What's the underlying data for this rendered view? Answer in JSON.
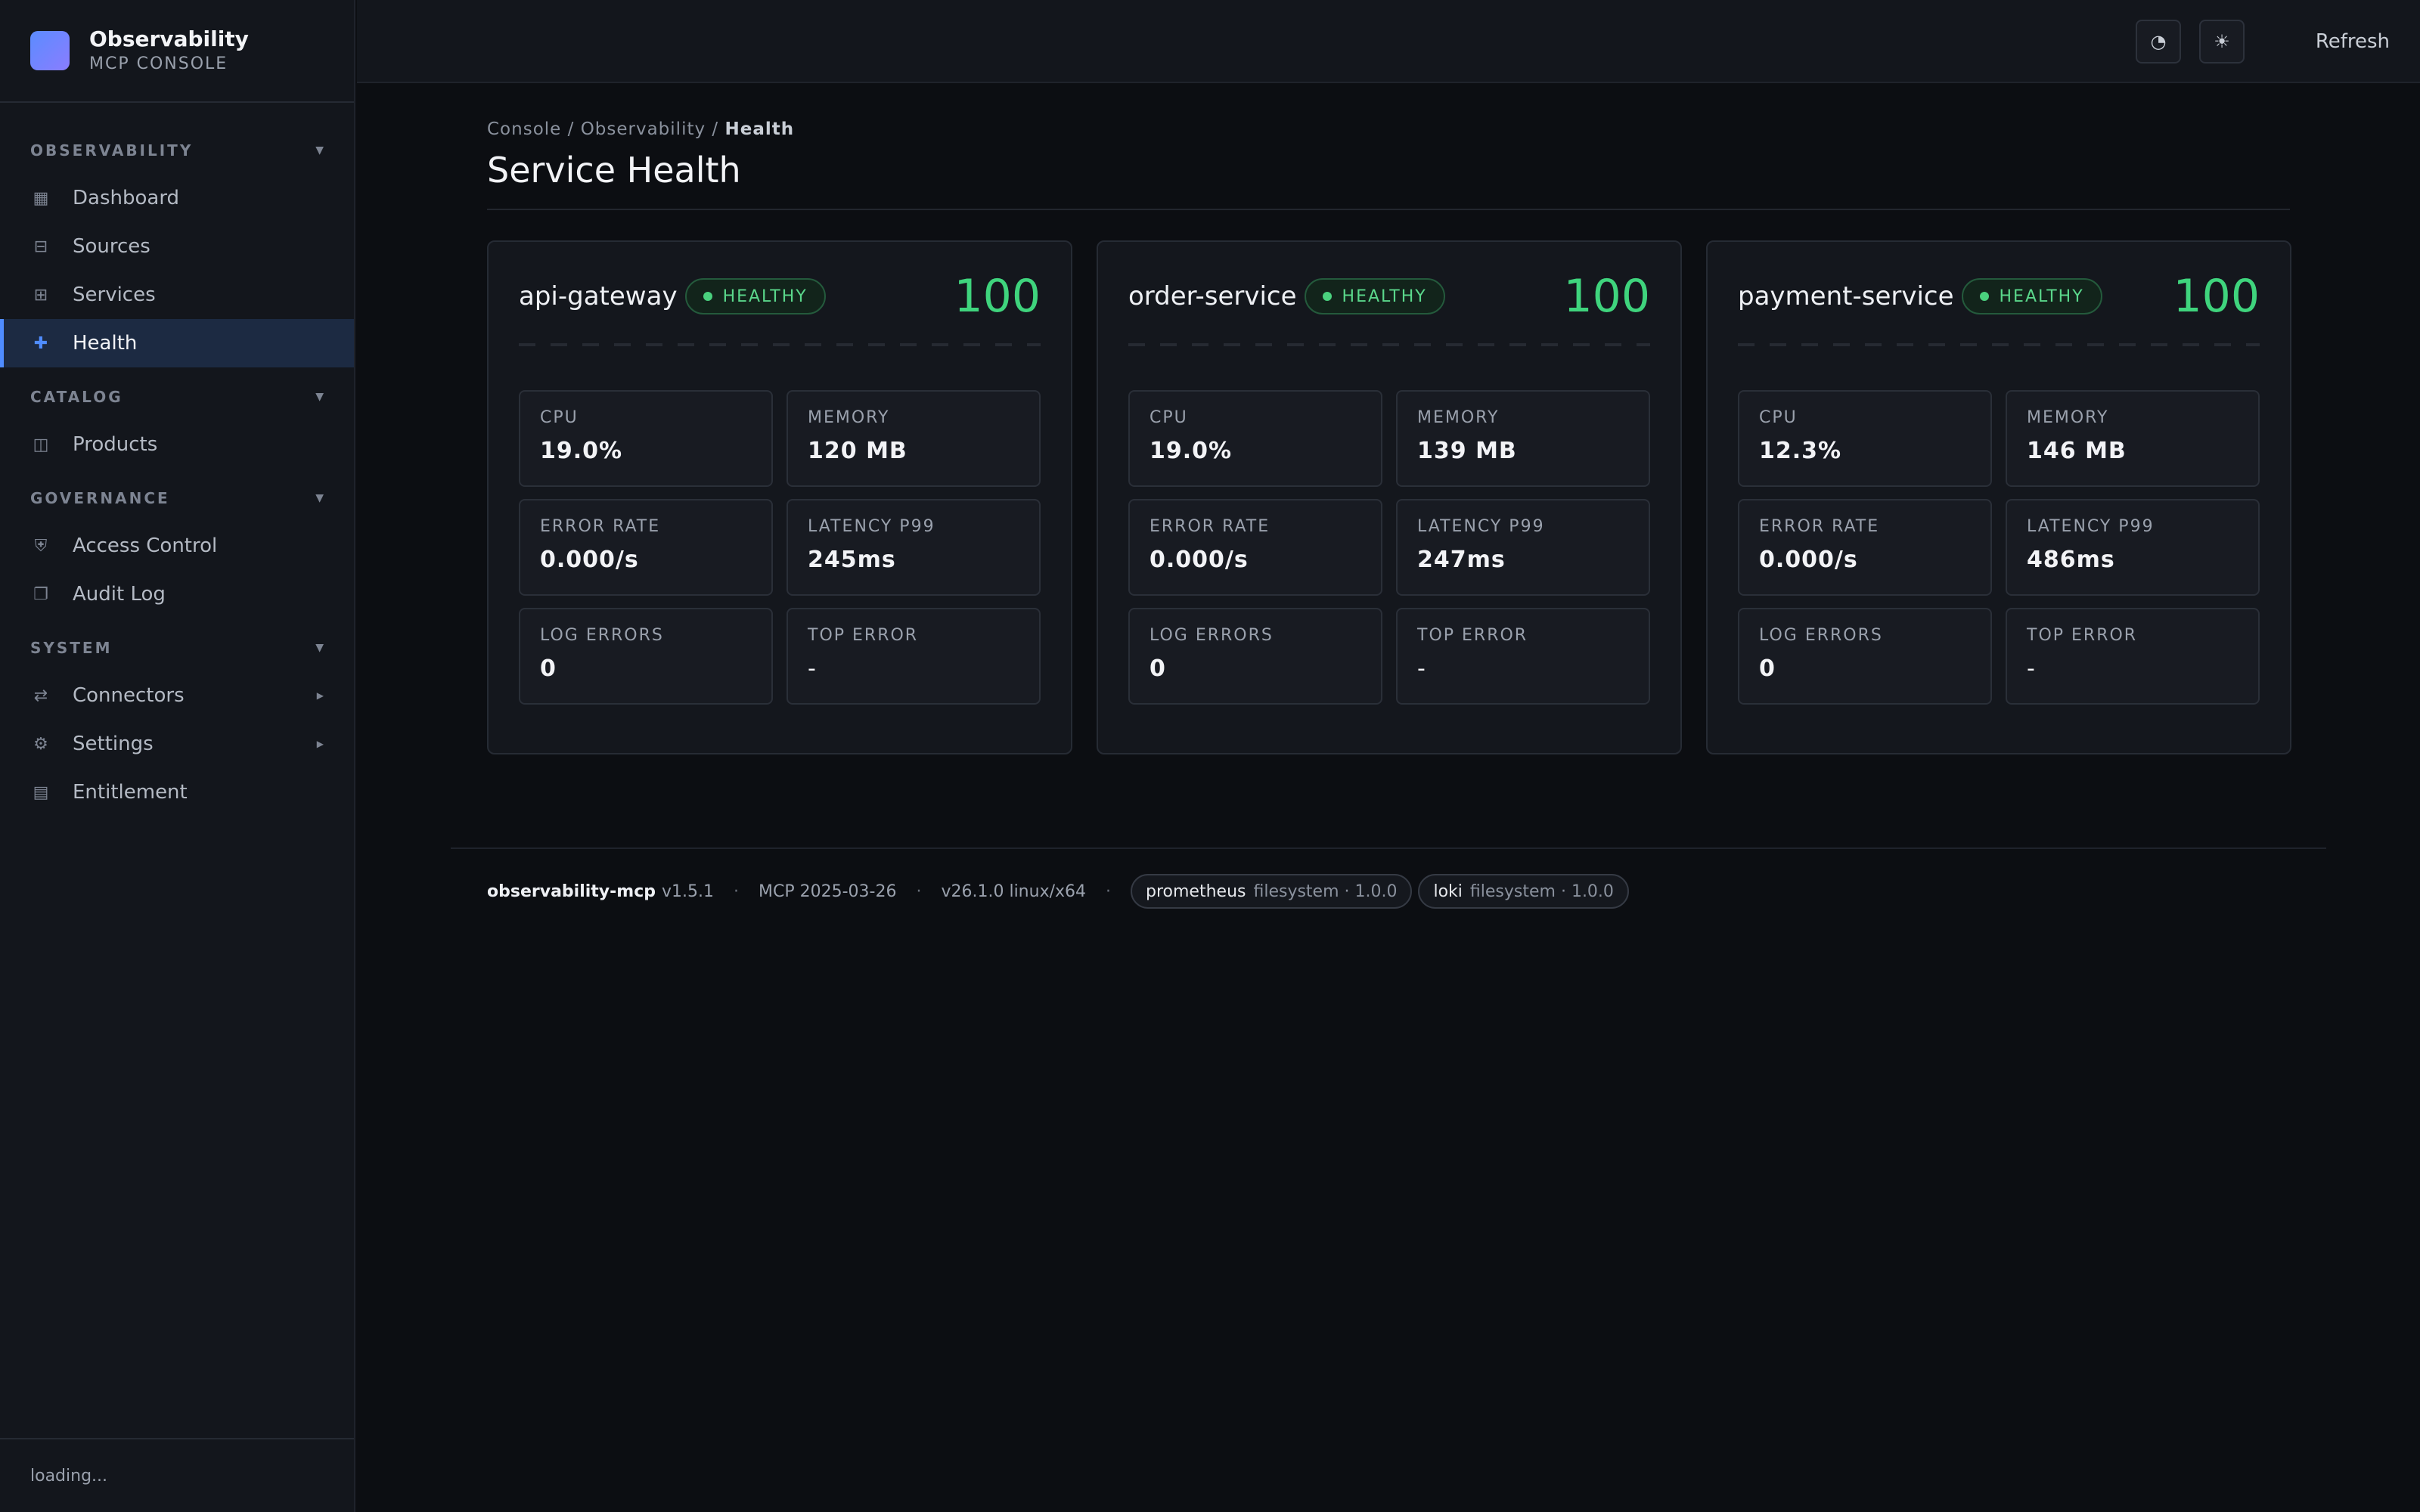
{
  "brand": {
    "name": "Observability",
    "subtitle": "MCP CONSOLE"
  },
  "nav": {
    "sections": [
      {
        "title": "OBSERVABILITY",
        "items": [
          {
            "label": "Dashboard",
            "icon": "grid-icon"
          },
          {
            "label": "Sources",
            "icon": "database-icon"
          },
          {
            "label": "Services",
            "icon": "services-icon"
          },
          {
            "label": "Health",
            "icon": "plus-icon",
            "active": true
          }
        ]
      },
      {
        "title": "CATALOG",
        "items": [
          {
            "label": "Products",
            "icon": "book-icon"
          }
        ]
      },
      {
        "title": "GOVERNANCE",
        "items": [
          {
            "label": "Access Control",
            "icon": "shield-icon"
          },
          {
            "label": "Audit Log",
            "icon": "document-icon"
          }
        ]
      },
      {
        "title": "SYSTEM",
        "items": [
          {
            "label": "Connectors",
            "icon": "connector-icon"
          },
          {
            "label": "Settings",
            "icon": "gear-icon"
          },
          {
            "label": "Entitlement",
            "icon": "license-icon"
          }
        ]
      }
    ],
    "footer_status": "loading..."
  },
  "topbar": {
    "refresh_label": "Refresh",
    "buttons": [
      "theme-contrast-icon",
      "sun-icon"
    ]
  },
  "breadcrumb": {
    "part1": "Console",
    "part2": "Observability",
    "current": "Health",
    "sep": " / "
  },
  "page_title": "Service Health",
  "services": [
    {
      "name": "api-gateway",
      "status": "HEALTHY",
      "score": "100",
      "metrics": {
        "cpu": {
          "label": "CPU",
          "value": "19.0%"
        },
        "memory": {
          "label": "MEMORY",
          "value": "120 MB"
        },
        "error_rate": {
          "label": "ERROR RATE",
          "value": "0.000/s"
        },
        "latency": {
          "label": "LATENCY P99",
          "value": "245ms"
        },
        "log_errors": {
          "label": "LOG ERRORS",
          "value": "0"
        },
        "top_error": {
          "label": "TOP ERROR",
          "value": "-"
        }
      }
    },
    {
      "name": "order-service",
      "status": "HEALTHY",
      "score": "100",
      "metrics": {
        "cpu": {
          "label": "CPU",
          "value": "19.0%"
        },
        "memory": {
          "label": "MEMORY",
          "value": "139 MB"
        },
        "error_rate": {
          "label": "ERROR RATE",
          "value": "0.000/s"
        },
        "latency": {
          "label": "LATENCY P99",
          "value": "247ms"
        },
        "log_errors": {
          "label": "LOG ERRORS",
          "value": "0"
        },
        "top_error": {
          "label": "TOP ERROR",
          "value": "-"
        }
      }
    },
    {
      "name": "payment-service",
      "status": "HEALTHY",
      "score": "100",
      "metrics": {
        "cpu": {
          "label": "CPU",
          "value": "12.3%"
        },
        "memory": {
          "label": "MEMORY",
          "value": "146 MB"
        },
        "error_rate": {
          "label": "ERROR RATE",
          "value": "0.000/s"
        },
        "latency": {
          "label": "LATENCY P99",
          "value": "486ms"
        },
        "log_errors": {
          "label": "LOG ERRORS",
          "value": "0"
        },
        "top_error": {
          "label": "TOP ERROR",
          "value": "-"
        }
      }
    }
  ],
  "footer": {
    "app": "observability-mcp",
    "app_version": "v1.5.1",
    "protocol": "MCP 2025-03-26",
    "runtime": "v26.1.0 linux/x64",
    "sep": "·",
    "plugins": [
      {
        "name": "prometheus",
        "meta": "filesystem · 1.0.0"
      },
      {
        "name": "loki",
        "meta": "filesystem · 1.0.0"
      }
    ]
  },
  "colors": {
    "accent": "#4f8cff",
    "healthy": "#3fd47d",
    "background": "#0c0e12",
    "sidebar": "#13161c"
  }
}
